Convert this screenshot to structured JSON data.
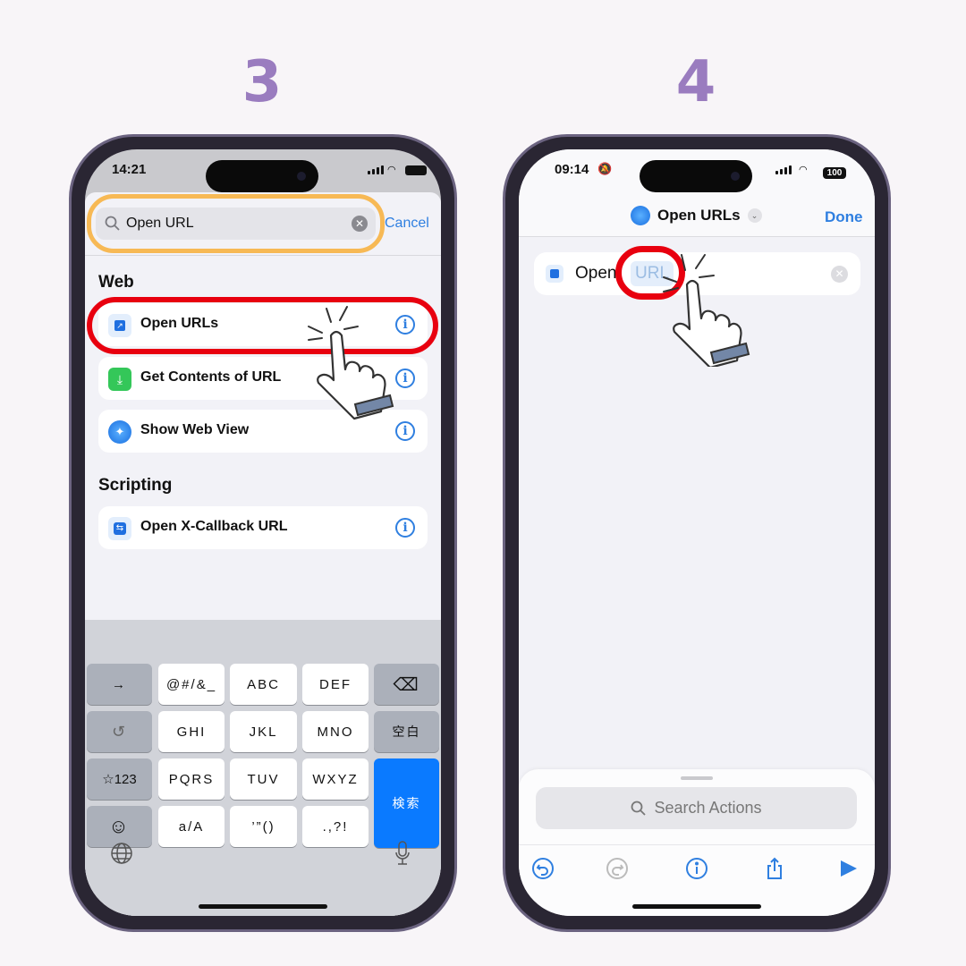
{
  "steps": [
    "3",
    "4"
  ],
  "colors": {
    "accent": "#9a7cbf",
    "highlight_red": "#e8000f",
    "highlight_orange": "#f7b955",
    "ios_blue": "#0a7aff"
  },
  "phone1": {
    "status": {
      "time": "14:21"
    },
    "search": {
      "value": "Open URL",
      "cancel_label": "Cancel",
      "icon": "search-icon"
    },
    "sections": [
      {
        "title": "Web",
        "items": [
          {
            "label": "Open URLs",
            "icon": "open-url-icon"
          },
          {
            "label": "Get Contents of URL",
            "icon": "download-icon"
          },
          {
            "label": "Show Web View",
            "icon": "safari-icon"
          }
        ]
      },
      {
        "title": "Scripting",
        "items": [
          {
            "label": "Open X-Callback URL",
            "icon": "callback-icon"
          }
        ]
      }
    ],
    "keyboard": {
      "rows": [
        [
          "→",
          "@#/&_",
          "ABC",
          "DEF",
          "⌫"
        ],
        [
          "↺",
          "GHI",
          "JKL",
          "MNO",
          "空白"
        ],
        [
          "☆123",
          "PQRS",
          "TUV",
          "WXYZ"
        ],
        [
          "☺",
          "a/A",
          "’”()",
          ".,?!"
        ]
      ],
      "enter": "検索",
      "bottom": [
        "globe-icon",
        "microphone-icon"
      ]
    }
  },
  "phone2": {
    "status": {
      "time": "09:14",
      "battery": "100"
    },
    "header": {
      "title": "Open URLs",
      "done_label": "Done"
    },
    "action": {
      "verb": "Open",
      "token": "URL"
    },
    "search_placeholder": "Search Actions",
    "toolbar": [
      "undo-icon",
      "redo-icon",
      "info-icon",
      "share-icon",
      "play-icon"
    ]
  }
}
